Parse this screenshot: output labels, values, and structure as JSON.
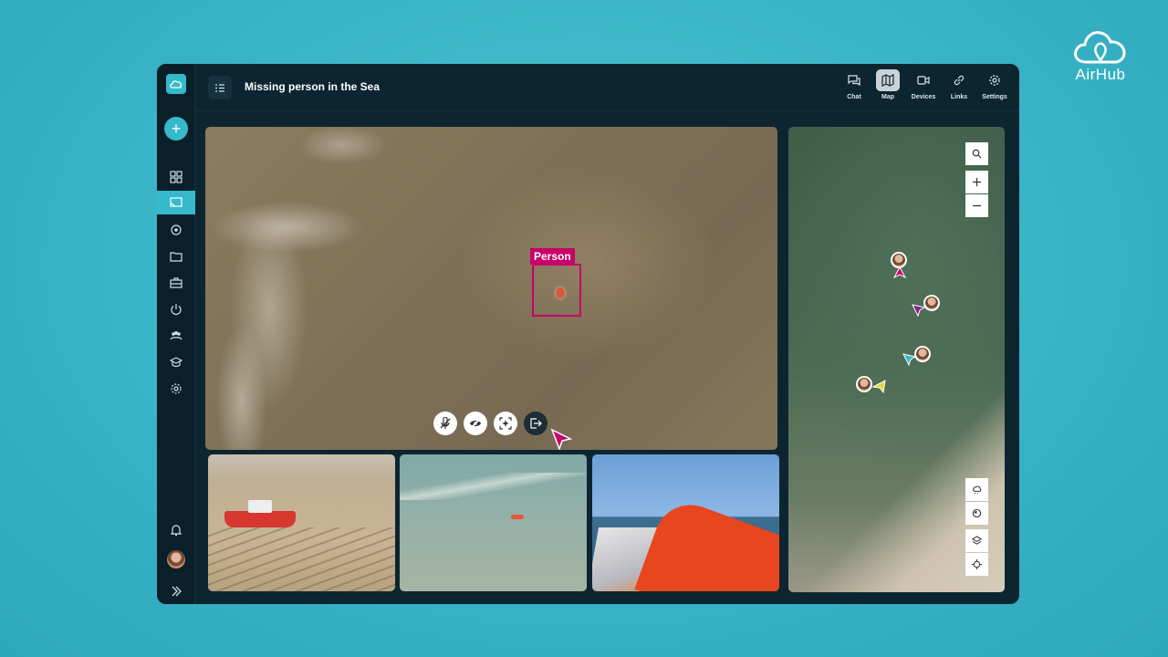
{
  "brand": {
    "name": "AirHub"
  },
  "header": {
    "title": "Missing person in the Sea"
  },
  "nav_tabs": [
    {
      "label": "Chat",
      "icon": "chat-icon",
      "active": false
    },
    {
      "label": "Map",
      "icon": "map-icon",
      "active": true
    },
    {
      "label": "Devices",
      "icon": "video-camera-icon",
      "active": false
    },
    {
      "label": "Links",
      "icon": "link-icon",
      "active": false
    },
    {
      "label": "Settings",
      "icon": "gear-icon",
      "active": false
    }
  ],
  "sidebar": {
    "items": [
      {
        "icon": "dashboard-icon",
        "active": false
      },
      {
        "icon": "cast-icon",
        "active": true
      },
      {
        "icon": "target-icon",
        "active": false
      },
      {
        "icon": "folder-icon",
        "active": false
      },
      {
        "icon": "toolbox-icon",
        "active": false
      },
      {
        "icon": "power-icon",
        "active": false
      },
      {
        "icon": "team-icon",
        "active": false
      },
      {
        "icon": "education-icon",
        "active": false
      },
      {
        "icon": "gear-icon",
        "active": false
      }
    ],
    "bottom": [
      {
        "icon": "bell-icon"
      },
      {
        "icon": "avatar"
      },
      {
        "icon": "expand-icon"
      }
    ]
  },
  "main_video": {
    "detection": {
      "label": "Person",
      "color": "#c8006a"
    },
    "controls": [
      "mute-icon",
      "hide-icon",
      "ai-detect-icon",
      "exit-icon"
    ]
  },
  "thumbnails": [
    {
      "name": "beach-lifeboat-feed"
    },
    {
      "name": "sea-drone-feed"
    },
    {
      "name": "boat-bow-feed"
    }
  ],
  "map": {
    "controls": [
      "search-icon",
      "zoom-in-icon",
      "zoom-out-icon"
    ],
    "tools": [
      "weather-icon",
      "airspace-icon",
      "layers-icon",
      "locate-icon"
    ],
    "markers": [
      {
        "color": "#c8006a"
      },
      {
        "color": "#8a1a8c"
      },
      {
        "color": "#35b9cb"
      },
      {
        "color": "#e6d43a"
      }
    ]
  },
  "colors": {
    "accent": "#35b9cb",
    "background": "#0d2530",
    "detection": "#c8006a"
  }
}
